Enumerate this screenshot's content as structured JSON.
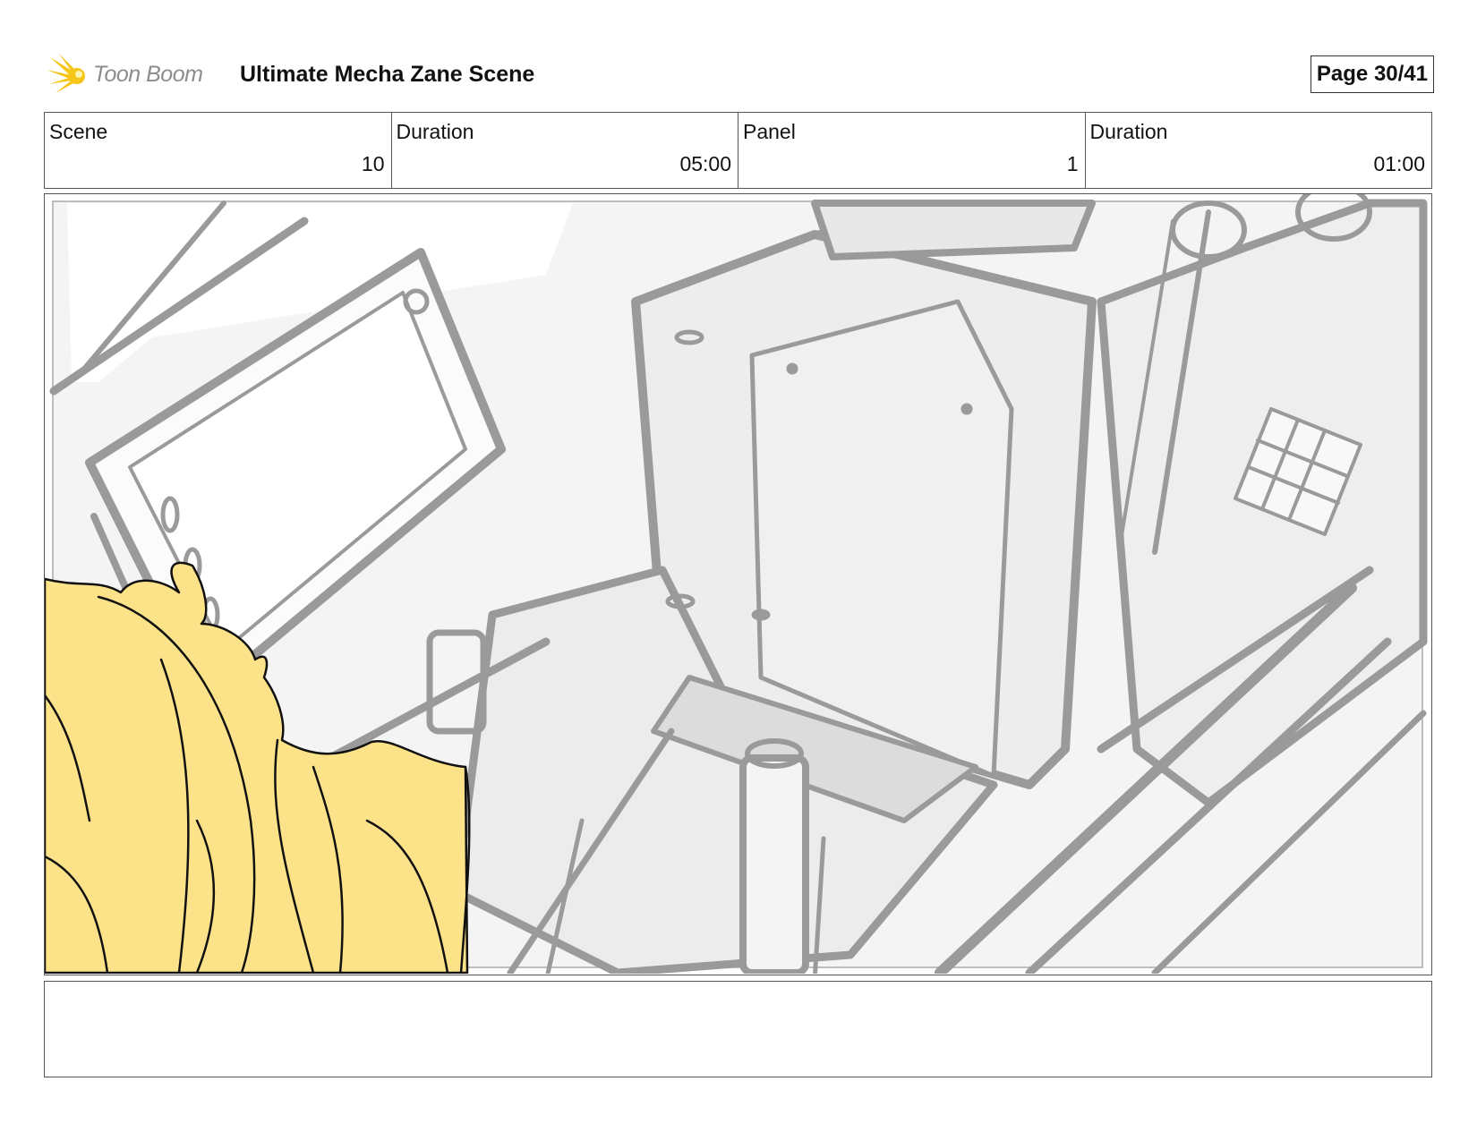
{
  "header": {
    "logo_text": "Toon Boom",
    "title": "Ultimate Mecha Zane Scene",
    "page_label": "Page 30/41"
  },
  "info": {
    "scene_label": "Scene",
    "scene_value": "10",
    "scene_duration_label": "Duration",
    "scene_duration_value": "05:00",
    "panel_label": "Panel",
    "panel_value": "1",
    "panel_duration_label": "Duration",
    "panel_duration_value": "01:00"
  },
  "panel": {
    "drawing_icon": "storyboard-sketch-cockpit-with-blonde-character"
  },
  "notes": {
    "text": ""
  },
  "colors": {
    "logo_yellow": "#f5c518",
    "hair_fill": "#fce38a",
    "sketch_gray": "#9a9a9a"
  }
}
